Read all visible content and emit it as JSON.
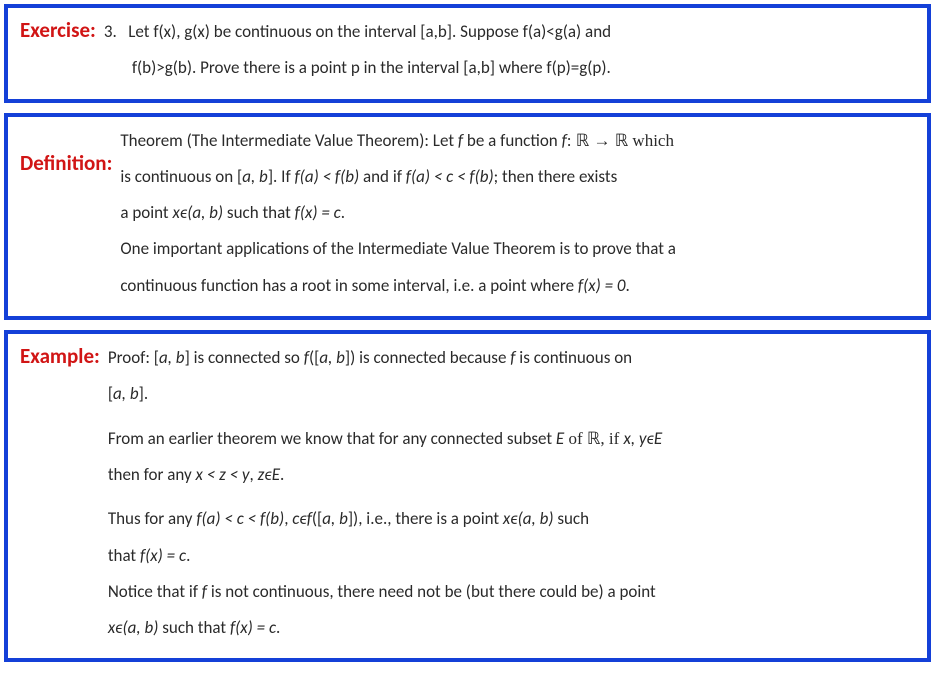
{
  "exercise": {
    "label": "Exercise:",
    "number": "3.",
    "line1": "Let f(x), g(x) be continuous on the interval [a,b].  Suppose f(a)<g(a) and",
    "line2": "f(b)>g(b).  Prove there is a point p in the interval [a,b] where f(p)=g(p)."
  },
  "definition": {
    "label": "Definition:",
    "line1a": "Theorem (The Intermediate Value Theorem):  Let ",
    "line1b": " be a function ",
    "line1c": ": ℝ → ℝ which",
    "line2a": "is continuous on [",
    "line2b": "].  If ",
    "line2c": " and if ",
    "line2d": ";  then there exists",
    "line3a": "a point ",
    "line3b": " such that ",
    "line3c": ".",
    "line4": "One important applications of the Intermediate Value Theorem is to prove that a",
    "line5a": "continuous function has a root in some interval, i.e. a point where ",
    "line5b": ".",
    "math": {
      "f": "f",
      "ab": "a, b",
      "fa_lt_fb": "f(a) < f(b)",
      "fa_lt_c_lt_fb": "f(a) < c < f(b)",
      "x_in_ab": "xϵ(a, b)",
      "fx_eq_c": "f(x) = c",
      "fx_eq_0": "f(x) = 0"
    }
  },
  "example": {
    "label": "Example:",
    "p1": {
      "line1a": "Proof:  [",
      "line1b": "] is connected so ",
      "line1c": "([",
      "line1d": "]) is connected because ",
      "line1e": " is continuous on",
      "line2a": "[",
      "line2b": "]."
    },
    "p2": {
      "line1a": "From an earlier theorem we know that for any connected subset ",
      "line1b": " of ℝ, if ",
      "line2a": "then for any ",
      "line2b": ",   ",
      "line2c": "."
    },
    "p3": {
      "line1a": "Thus for any ",
      "line1b": ",  ",
      "line1c": "([",
      "line1d": "]),  i.e., there is a point ",
      "line1e": " such",
      "line2a": "that ",
      "line2b": "."
    },
    "p4": {
      "line1a": "Notice that if ",
      "line1b": " is not continuous, there need not be (but there could be) a point",
      "line2a": "",
      "line2b": " such that ",
      "line2c": "."
    },
    "math": {
      "ab": "a, b",
      "f": "f",
      "E": "E",
      "xy_in_E": "x, yϵE",
      "x_lt_z_lt_y": "x < z < y",
      "z_in_E": "zϵE",
      "fa_lt_c_lt_fb": "f(a) < c < f(b)",
      "c_in_f": "cϵf",
      "x_in_ab": "xϵ(a, b)",
      "fx_eq_c": "f(x) = c"
    }
  }
}
